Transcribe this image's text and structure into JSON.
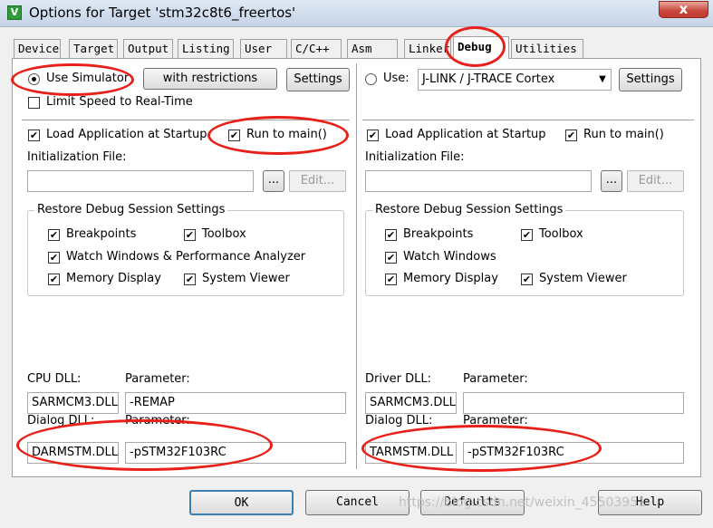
{
  "window": {
    "title": "Options for Target 'stm32c8t6_freertos'",
    "icon_glyph": "V",
    "close_glyph": "x"
  },
  "tabs": [
    {
      "label": "Device",
      "active": false
    },
    {
      "label": "Target",
      "active": false
    },
    {
      "label": "Output",
      "active": false
    },
    {
      "label": "Listing",
      "active": false
    },
    {
      "label": "User",
      "active": false
    },
    {
      "label": "C/C++",
      "active": false
    },
    {
      "label": "Asm",
      "active": false
    },
    {
      "label": "Linker",
      "active": false
    },
    {
      "label": "Debug",
      "active": true
    },
    {
      "label": "Utilities",
      "active": false
    }
  ],
  "left": {
    "use_simulator_label": "Use Simulator",
    "use_simulator_selected": true,
    "with_restrictions_label": "with restrictions",
    "settings_label": "Settings",
    "limit_speed_label": "Limit Speed to Real-Time",
    "limit_speed_checked": false,
    "load_app_label": "Load Application at Startup",
    "load_app_checked": true,
    "run_to_main_label": "Run to main()",
    "run_to_main_checked": true,
    "init_file_label": "Initialization File:",
    "init_file_value": "",
    "browse_label": "...",
    "edit_label": "Edit...",
    "restore_group_title": "Restore Debug Session Settings",
    "breakpoints_label": "Breakpoints",
    "toolbox_label": "Toolbox",
    "watch_label": "Watch Windows & Performance Analyzer",
    "memory_label": "Memory Display",
    "system_viewer_label": "System Viewer",
    "cpu_dll_label": "CPU DLL:",
    "cpu_param_label": "Parameter:",
    "cpu_dll_value": "SARMCM3.DLL",
    "cpu_param_value": "-REMAP",
    "dialog_dll_label": "Dialog DLL:",
    "dialog_param_label": "Parameter:",
    "dialog_dll_value": "DARMSTM.DLL",
    "dialog_param_value": "-pSTM32F103RC"
  },
  "right": {
    "use_label": "Use:",
    "use_selected": false,
    "debugger_value": "J-LINK / J-TRACE Cortex",
    "settings_label": "Settings",
    "load_app_label": "Load Application at Startup",
    "load_app_checked": true,
    "run_to_main_label": "Run to main()",
    "run_to_main_checked": true,
    "init_file_label": "Initialization File:",
    "init_file_value": "",
    "browse_label": "...",
    "edit_label": "Edit...",
    "restore_group_title": "Restore Debug Session Settings",
    "breakpoints_label": "Breakpoints",
    "toolbox_label": "Toolbox",
    "watch_label": "Watch Windows",
    "memory_label": "Memory Display",
    "system_viewer_label": "System Viewer",
    "driver_dll_label": "Driver DLL:",
    "driver_param_label": "Parameter:",
    "driver_dll_value": "SARMCM3.DLL",
    "driver_param_value": "",
    "dialog_dll_label": "Dialog DLL:",
    "dialog_param_label": "Parameter:",
    "dialog_dll_value": "TARMSTM.DLL",
    "dialog_param_value": "-pSTM32F103RC"
  },
  "buttons": {
    "ok": "OK",
    "cancel": "Cancel",
    "defaults": "Defaults",
    "help": "Help"
  },
  "check_glyph": "✔",
  "dropdown_glyph": "▼",
  "watermark": "https://blog.csdn.net/weixin_45503951",
  "colors": {
    "annotation": "#e8201a",
    "tab_active_bg": "#ffffff",
    "dialog_bg": "#f0f0f0"
  }
}
